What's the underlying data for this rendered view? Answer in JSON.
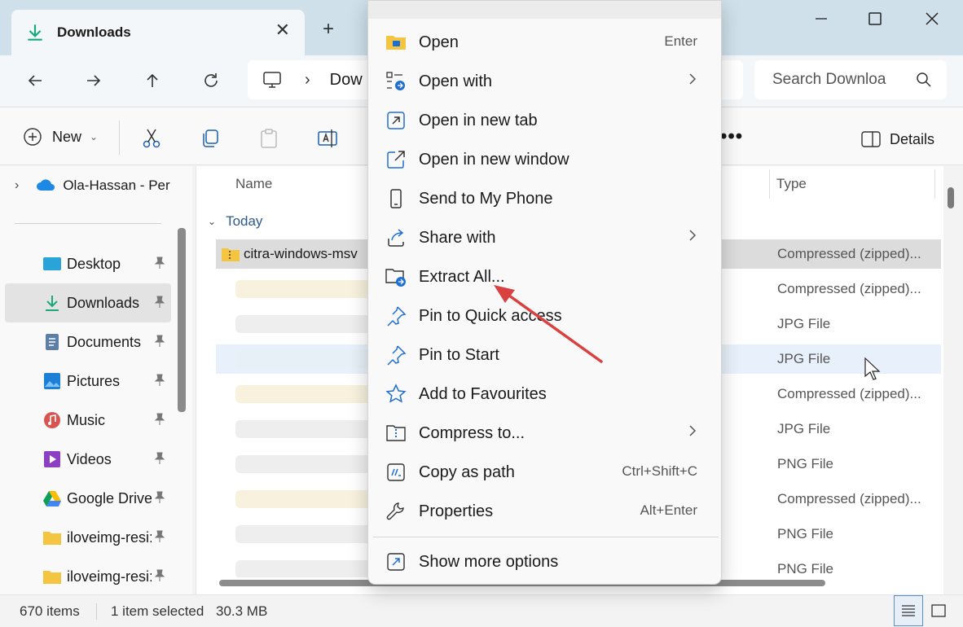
{
  "window": {
    "tab_title": "Downloads",
    "new_tab": "+"
  },
  "nav": {
    "breadcrumb_separator": "›",
    "breadcrumb_current": "Dow",
    "search_placeholder": "Search Downloa"
  },
  "command_bar": {
    "new_label": "New",
    "more_label": "•••",
    "details_label": "Details"
  },
  "sidebar": {
    "top_item": "Ola-Hassan - Per",
    "items": [
      {
        "label": "Desktop",
        "icon": "desktop-icon",
        "pinned": true
      },
      {
        "label": "Downloads",
        "icon": "download-icon",
        "pinned": true,
        "selected": true
      },
      {
        "label": "Documents",
        "icon": "documents-icon",
        "pinned": true
      },
      {
        "label": "Pictures",
        "icon": "pictures-icon",
        "pinned": true
      },
      {
        "label": "Music",
        "icon": "music-icon",
        "pinned": true
      },
      {
        "label": "Videos",
        "icon": "videos-icon",
        "pinned": true
      },
      {
        "label": "Google Drive",
        "icon": "google-drive-icon",
        "pinned": true
      },
      {
        "label": "iloveimg-resi:",
        "icon": "folder-icon",
        "pinned": true
      },
      {
        "label": "iloveimg-resi:",
        "icon": "folder-icon",
        "pinned": true
      }
    ]
  },
  "file_list": {
    "columns": {
      "name": "Name",
      "type": "Type"
    },
    "group": "Today",
    "rows": [
      {
        "name": "citra-windows-msv",
        "type": "Compressed (zipped)..."
      },
      {
        "name": "",
        "type": "Compressed (zipped)..."
      },
      {
        "name": "",
        "type": "JPG File"
      },
      {
        "name": "",
        "type": "JPG File"
      },
      {
        "name": "",
        "type": "Compressed (zipped)..."
      },
      {
        "name": "",
        "type": "JPG File"
      },
      {
        "name": "",
        "type": "PNG File"
      },
      {
        "name": "",
        "type": "Compressed (zipped)..."
      },
      {
        "name": "",
        "type": "PNG File"
      },
      {
        "name": "",
        "type": "PNG File"
      }
    ]
  },
  "status": {
    "item_count": "670 items",
    "selection": "1 item selected",
    "size": "30.3 MB"
  },
  "context_menu": {
    "items": [
      {
        "label": "Open",
        "shortcut": "Enter",
        "icon": "folder-open-icon"
      },
      {
        "label": "Open with",
        "shortcut": "",
        "icon": "open-with-icon",
        "submenu": true
      },
      {
        "label": "Open in new tab",
        "shortcut": "",
        "icon": "new-tab-icon"
      },
      {
        "label": "Open in new window",
        "shortcut": "",
        "icon": "new-window-icon"
      },
      {
        "label": "Send to My Phone",
        "shortcut": "",
        "icon": "phone-icon"
      },
      {
        "label": "Share with",
        "shortcut": "",
        "icon": "share-icon",
        "submenu": true
      },
      {
        "label": "Extract All...",
        "shortcut": "",
        "icon": "extract-icon"
      },
      {
        "label": "Pin to Quick access",
        "shortcut": "",
        "icon": "pin-icon"
      },
      {
        "label": "Pin to Start",
        "shortcut": "",
        "icon": "pin-icon"
      },
      {
        "label": "Add to Favourites",
        "shortcut": "",
        "icon": "star-icon"
      },
      {
        "label": "Compress to...",
        "shortcut": "",
        "icon": "compress-icon",
        "submenu": true
      },
      {
        "label": "Copy as path",
        "shortcut": "Ctrl+Shift+C",
        "icon": "copy-path-icon"
      },
      {
        "label": "Properties",
        "shortcut": "Alt+Enter",
        "icon": "wrench-icon"
      }
    ],
    "more_options": "Show more options"
  },
  "colors": {
    "accent": "#0067c0",
    "annotation_arrow": "#d94141",
    "titlebar": "#cfe0ea"
  }
}
